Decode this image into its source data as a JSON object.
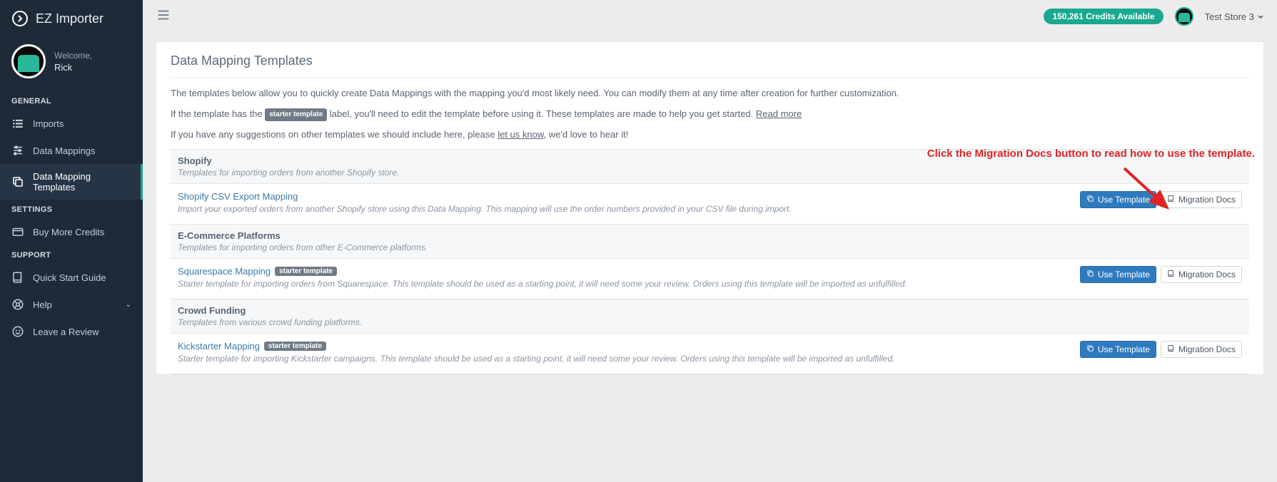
{
  "brand": "EZ Importer",
  "welcome": "Welcome,",
  "username": "Rick",
  "nav": {
    "general_label": "GENERAL",
    "imports": "Imports",
    "data_mappings": "Data Mappings",
    "data_mapping_templates": "Data Mapping Templates",
    "settings_label": "SETTINGS",
    "buy_more_credits": "Buy More Credits",
    "support_label": "SUPPORT",
    "quick_start_guide": "Quick Start Guide",
    "help": "Help",
    "leave_review": "Leave a Review"
  },
  "topbar": {
    "credits": "150,261 Credits Available",
    "store": "Test Store 3"
  },
  "page": {
    "title": "Data Mapping Templates",
    "intro1": "The templates below allow you to quickly create Data Mappings with the mapping you'd most likely need. You can modify them at any time after creation for further customization.",
    "intro2_pre": "If the template has the ",
    "intro2_badge": "starter template",
    "intro2_post": " label, you'll need to edit the template before using it. These templates are made to help you get started. ",
    "intro2_link": "Read more",
    "intro3_pre": "If you have any suggestions on other templates we should include here, please ",
    "intro3_link": "let us know",
    "intro3_post": ", we'd love to hear it!",
    "annotation": "Click the Migration Docs button to read how to use the template."
  },
  "buttons": {
    "use_template": "Use Template",
    "migration_docs": "Migration Docs"
  },
  "groups": [
    {
      "title": "Shopify",
      "desc": "Templates for importing orders from another Shopify store.",
      "templates": [
        {
          "title": "Shopify CSV Export Mapping",
          "starter": false,
          "desc": "Import your exported orders from another Shopify store using this Data Mapping. This mapping will use the order numbers provided in your CSV file during import."
        }
      ]
    },
    {
      "title": "E-Commerce Platforms",
      "desc": "Templates for importing orders from other E-Commerce platforms.",
      "templates": [
        {
          "title": "Squarespace Mapping",
          "starter": true,
          "desc": "Starter template for importing orders from Squarespace. This template should be used as a starting point, it will need some your review. Orders using this template will be imported as unfulfilled."
        }
      ]
    },
    {
      "title": "Crowd Funding",
      "desc": "Templates from various crowd funding platforms.",
      "templates": [
        {
          "title": "Kickstarter Mapping",
          "starter": true,
          "desc": "Starter template for importing Kickstarter campaigns. This template should be used as a starting point, it will need some your review. Orders using this template will be imported as unfulfilled."
        }
      ]
    }
  ]
}
